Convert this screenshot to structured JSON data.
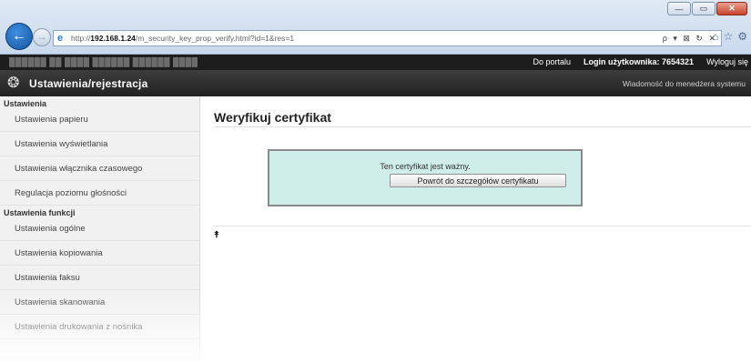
{
  "browser": {
    "url_prefix": "http://",
    "url_host": "192.168.1.24",
    "url_path": "/m_security_key_prop_verify.html?id=1&res=1",
    "address_tools": "ρ ▾ ⊠ ↻ ✕",
    "home_icons": [
      "⌂",
      "☆",
      "⚙"
    ],
    "window_controls": [
      "—",
      "▭",
      "✕"
    ]
  },
  "topbar": {
    "device_name": "██████  ██ ████ ██████  ██████  ████",
    "portal_link": "Do portalu",
    "login_label": "Login użytkownika:",
    "login_value": "7654321",
    "logout_link": "Wyloguj się"
  },
  "titlebar": {
    "title": "Ustawienia/rejestracja",
    "admin_message": "Wiadomość do menedżera systemu"
  },
  "sidebar": {
    "sections": [
      {
        "heading": "Ustawienia",
        "items": [
          "Ustawienia papieru",
          "Ustawienia wyświetlania",
          "Ustawienia włącznika czasowego",
          "Regulacja poziomu głośności"
        ]
      },
      {
        "heading": "Ustawienia funkcji",
        "items": [
          "Ustawienia ogólne",
          "Ustawienia kopiowania",
          "Ustawienia faksu",
          "Ustawienia skanowania",
          "Ustawienia drukowania z nośnika"
        ]
      }
    ]
  },
  "main": {
    "title": "Weryfikuj certyfikat",
    "message": "Ten certyfikat jest ważny.",
    "back_button": "Powrót do szczegółów certyfikatu",
    "top_icon": "⯭"
  }
}
